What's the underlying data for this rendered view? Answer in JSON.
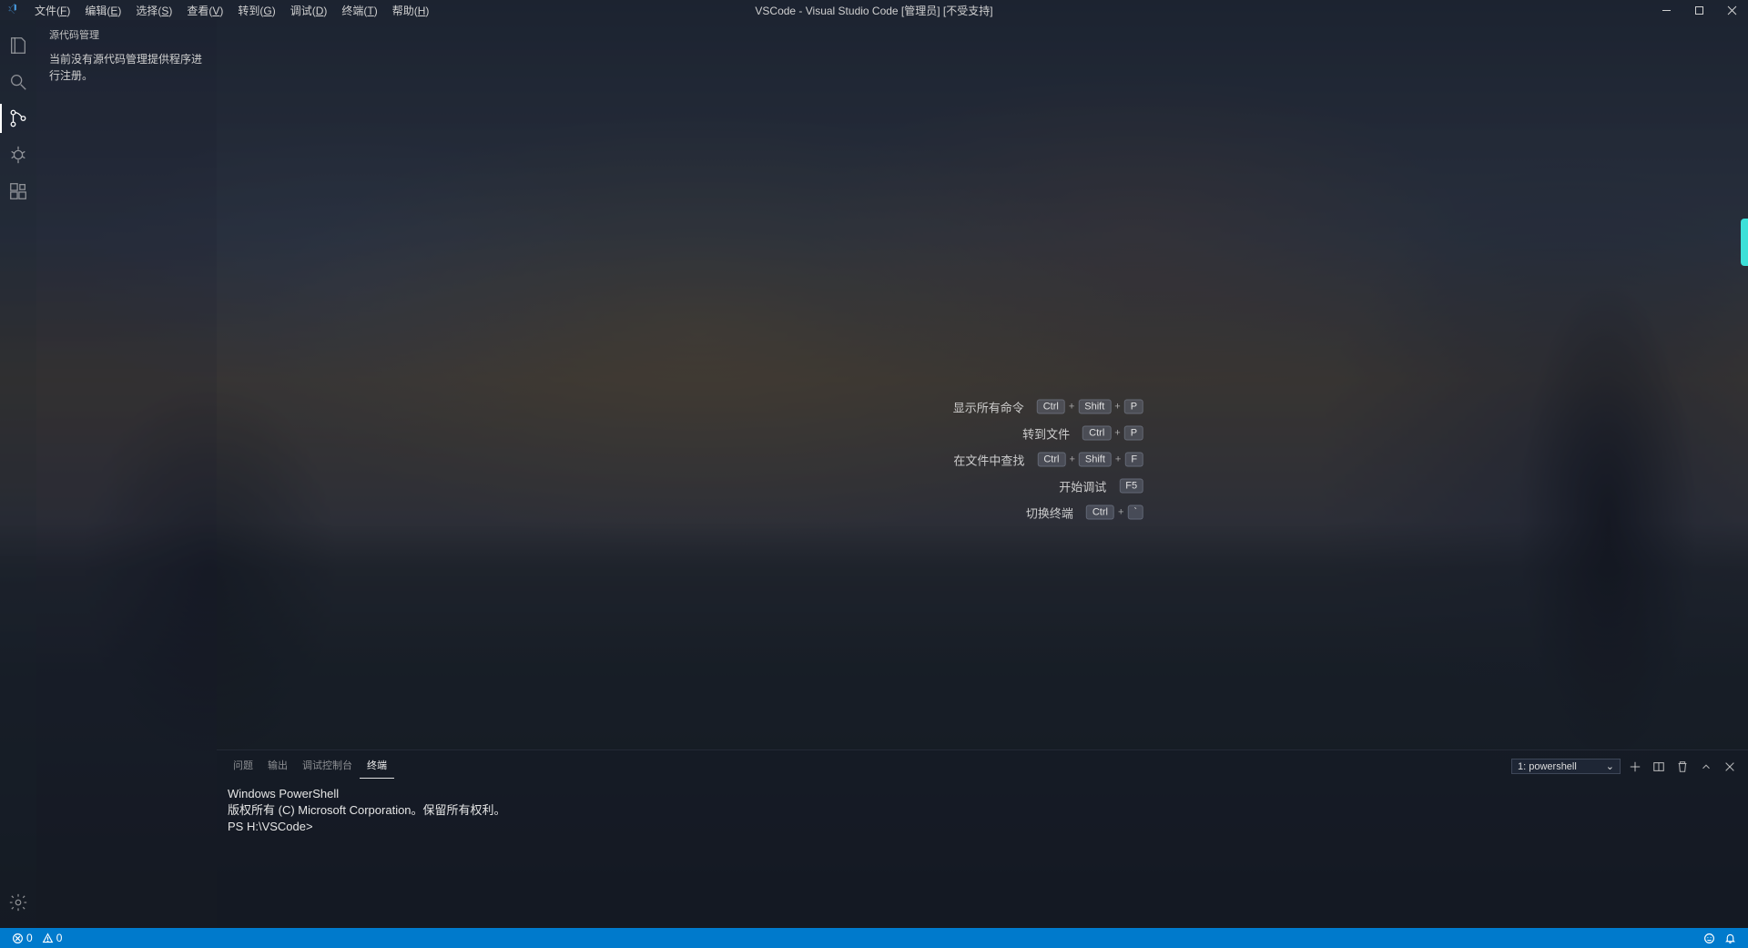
{
  "title": "VSCode - Visual Studio Code [管理员] [不受支持]",
  "menubar": [
    {
      "label": "文件",
      "mn": "F"
    },
    {
      "label": "编辑",
      "mn": "E"
    },
    {
      "label": "选择",
      "mn": "S"
    },
    {
      "label": "查看",
      "mn": "V"
    },
    {
      "label": "转到",
      "mn": "G"
    },
    {
      "label": "调试",
      "mn": "D"
    },
    {
      "label": "终端",
      "mn": "T"
    },
    {
      "label": "帮助",
      "mn": "H"
    }
  ],
  "sidebar": {
    "title": "源代码管理",
    "message": "当前没有源代码管理提供程序进行注册。"
  },
  "welcome_hints": [
    {
      "label": "显示所有命令",
      "keys": [
        "Ctrl",
        "Shift",
        "P"
      ]
    },
    {
      "label": "转到文件",
      "keys": [
        "Ctrl",
        "P"
      ]
    },
    {
      "label": "在文件中查找",
      "keys": [
        "Ctrl",
        "Shift",
        "F"
      ]
    },
    {
      "label": "开始调试",
      "keys": [
        "F5"
      ]
    },
    {
      "label": "切换终端",
      "keys": [
        "Ctrl",
        "`"
      ]
    }
  ],
  "panel": {
    "tabs": [
      {
        "label": "问题",
        "active": false
      },
      {
        "label": "输出",
        "active": false
      },
      {
        "label": "调试控制台",
        "active": false
      },
      {
        "label": "终端",
        "active": true
      }
    ],
    "terminal_selector": "1: powershell",
    "terminal_lines": [
      "Windows PowerShell",
      "版权所有 (C) Microsoft Corporation。保留所有权利。",
      "",
      "PS H:\\VSCode>"
    ]
  },
  "statusbar": {
    "errors": "0",
    "warnings": "0"
  }
}
